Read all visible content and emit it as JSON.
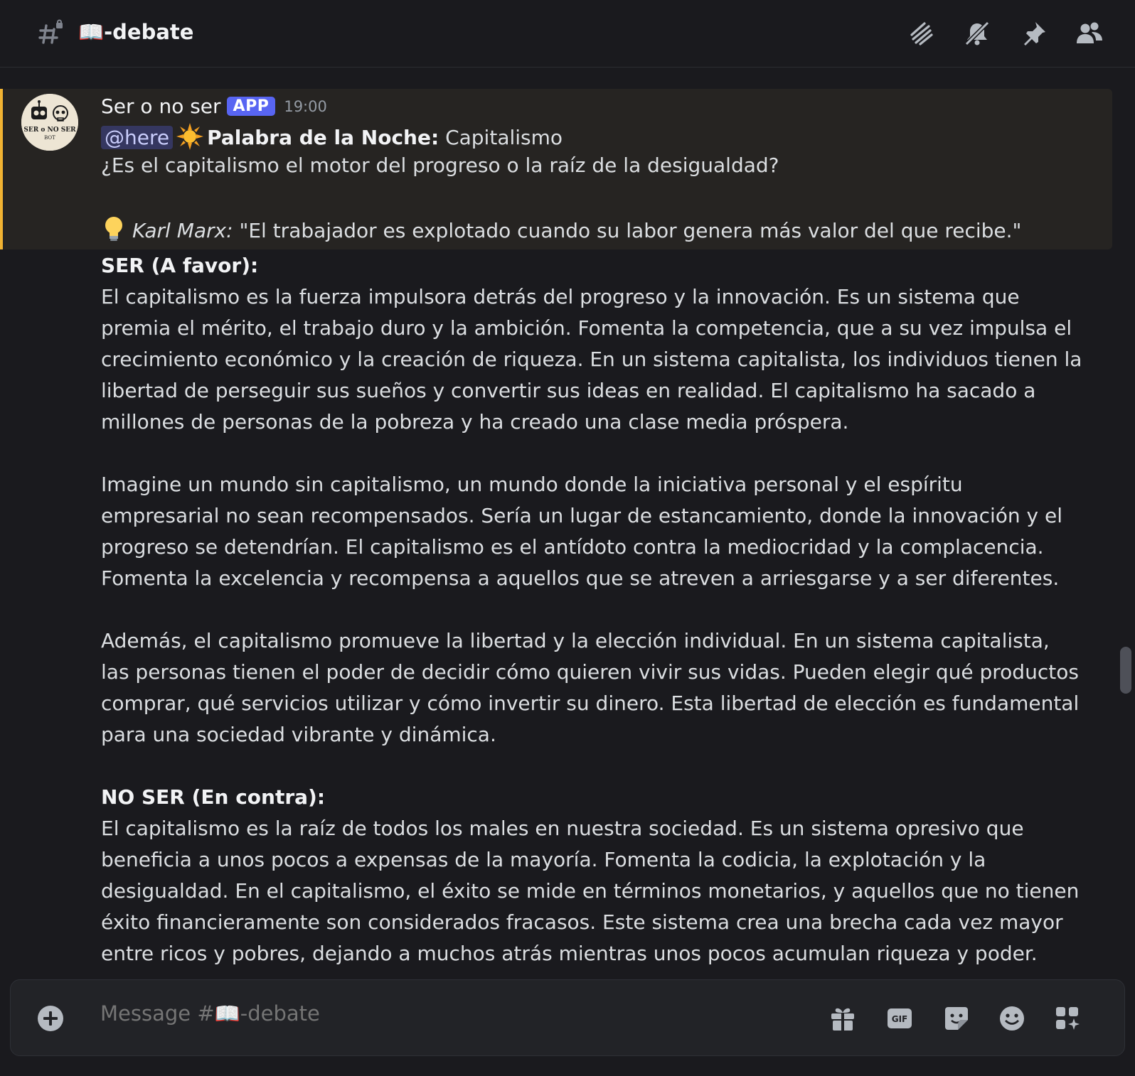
{
  "header": {
    "channel_name": "📖-debate",
    "icons": [
      "threads-icon",
      "mute-bell-icon",
      "pin-icon",
      "members-icon"
    ]
  },
  "message": {
    "author": "Ser o no ser",
    "badge": "APP",
    "timestamp": "19:00",
    "avatar_text": "SER o NO SER",
    "avatar_subtext": "BOT",
    "mention": "@here",
    "headline_label": "Palabra de la Noche:",
    "headline_value": "Capitalismo",
    "question": "¿Es el capitalismo el motor del progreso o la raíz de la desigualdad?",
    "quote_author": "Karl Marx:",
    "quote_text": "\"El trabajador es explotado cuando su labor genera más valor del que recibe.\"",
    "highlight_color": "#f0b232"
  },
  "body": {
    "ser_title": "SER (A favor):",
    "ser_p1": "El capitalismo es la fuerza impulsora detrás del progreso y la innovación. Es un sistema que premia el mérito, el trabajo duro y la ambición. Fomenta la competencia, que a su vez impulsa el crecimiento económico y la creación de riqueza. En un sistema capitalista, los individuos tienen la libertad de perseguir sus sueños y convertir sus ideas en realidad. El capitalismo ha sacado a millones de personas de la pobreza y ha creado una clase media próspera.",
    "ser_p2": "Imagine un mundo sin capitalismo, un mundo donde la iniciativa personal y el espíritu empresarial no sean recompensados. Sería un lugar de estancamiento, donde la innovación y el progreso se detendrían. El capitalismo es el antídoto contra la mediocridad y la complacencia. Fomenta la excelencia y recompensa a aquellos que se atreven a arriesgarse y a ser diferentes.",
    "ser_p3": "Además, el capitalismo promueve la libertad y la elección individual. En un sistema capitalista, las personas tienen el poder de decidir cómo quieren vivir sus vidas. Pueden elegir qué productos comprar, qué servicios utilizar y cómo invertir su dinero. Esta libertad de elección es fundamental para una sociedad vibrante y dinámica.",
    "noser_title": "NO SER (En contra):",
    "noser_p1": "El capitalismo es la raíz de todos los males en nuestra sociedad. Es un sistema opresivo que beneficia a unos pocos a expensas de la mayoría. Fomenta la codicia, la explotación y la desigualdad. En el capitalismo, el éxito se mide en términos monetarios, y aquellos que no tienen éxito financieramente son considerados fracasos. Este sistema crea una brecha cada vez mayor entre ricos y pobres, dejando a muchos atrás mientras unos pocos acumulan riqueza y poder."
  },
  "composer": {
    "placeholder": "Message #📖-debate",
    "icons": [
      "plus-icon",
      "gift-icon",
      "gif-icon",
      "sticker-icon",
      "emoji-icon",
      "apps-icon"
    ]
  }
}
